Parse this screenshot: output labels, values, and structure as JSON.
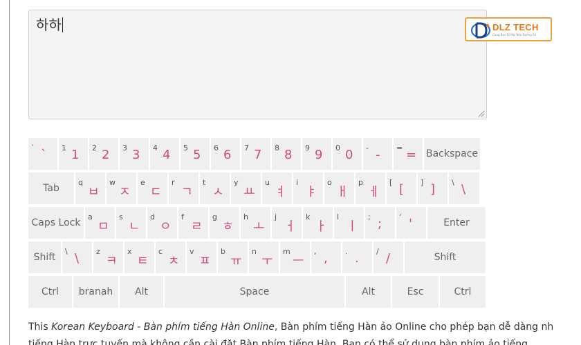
{
  "textarea": {
    "value": "하하"
  },
  "logo": {
    "text": "DLZ TECH",
    "tagline": "Cùng Bạn Đi Mọi Nẻo Đường Số"
  },
  "keyboard": {
    "rows": [
      [
        {
          "sm": "`",
          "big": "`"
        },
        {
          "sm": "1",
          "big": "1"
        },
        {
          "sm": "2",
          "big": "2"
        },
        {
          "sm": "3",
          "big": "3"
        },
        {
          "sm": "4",
          "big": "4"
        },
        {
          "sm": "5",
          "big": "5"
        },
        {
          "sm": "6",
          "big": "6"
        },
        {
          "sm": "7",
          "big": "7"
        },
        {
          "sm": "8",
          "big": "8"
        },
        {
          "sm": "9",
          "big": "9"
        },
        {
          "sm": "0",
          "big": "0"
        },
        {
          "sm": "-",
          "big": "-"
        },
        {
          "sm": "=",
          "big": "="
        },
        {
          "label": "Backspace"
        }
      ],
      [
        {
          "label": "Tab"
        },
        {
          "sm": "q",
          "big": "ㅂ"
        },
        {
          "sm": "w",
          "big": "ㅈ"
        },
        {
          "sm": "e",
          "big": "ㄷ"
        },
        {
          "sm": "r",
          "big": "ㄱ"
        },
        {
          "sm": "t",
          "big": "ㅅ"
        },
        {
          "sm": "y",
          "big": "ㅛ"
        },
        {
          "sm": "u",
          "big": "ㅕ"
        },
        {
          "sm": "i",
          "big": "ㅑ"
        },
        {
          "sm": "o",
          "big": "ㅐ"
        },
        {
          "sm": "p",
          "big": "ㅔ"
        },
        {
          "sm": "[",
          "big": "["
        },
        {
          "sm": "]",
          "big": "]"
        },
        {
          "sm": "\\",
          "big": "\\"
        }
      ],
      [
        {
          "label": "Caps Lock"
        },
        {
          "sm": "a",
          "big": "ㅁ"
        },
        {
          "sm": "s",
          "big": "ㄴ"
        },
        {
          "sm": "d",
          "big": "ㅇ"
        },
        {
          "sm": "f",
          "big": "ㄹ"
        },
        {
          "sm": "g",
          "big": "ㅎ"
        },
        {
          "sm": "h",
          "big": "ㅗ"
        },
        {
          "sm": "j",
          "big": "ㅓ"
        },
        {
          "sm": "k",
          "big": "ㅏ"
        },
        {
          "sm": "l",
          "big": "ㅣ"
        },
        {
          "sm": ";",
          "big": ";"
        },
        {
          "sm": "'",
          "big": "'"
        },
        {
          "label": "Enter"
        }
      ],
      [
        {
          "label": "Shift"
        },
        {
          "sm": "\\",
          "big": "\\"
        },
        {
          "sm": "z",
          "big": "ㅋ"
        },
        {
          "sm": "x",
          "big": "ㅌ"
        },
        {
          "sm": "c",
          "big": "ㅊ"
        },
        {
          "sm": "v",
          "big": "ㅍ"
        },
        {
          "sm": "b",
          "big": "ㅠ"
        },
        {
          "sm": "n",
          "big": "ㅜ"
        },
        {
          "sm": "m",
          "big": "ㅡ"
        },
        {
          "sm": ",",
          "big": ","
        },
        {
          "sm": ".",
          "big": "."
        },
        {
          "sm": "/",
          "big": "/"
        },
        {
          "label": "Shift"
        }
      ],
      [
        {
          "label": "Ctrl"
        },
        {
          "label": "branah"
        },
        {
          "label": "Alt"
        },
        {
          "label": "Space"
        },
        {
          "label": "Alt"
        },
        {
          "label": "Esc"
        },
        {
          "label": "Ctrl"
        }
      ]
    ]
  },
  "description": {
    "lead": "This ",
    "title_italic": "Korean Keyboard - Bàn phím tiếng Hàn Online",
    "rest": ", Bàn phím tiếng Hàn ảo Online cho phép bạn dễ dàng nh",
    "line2": "tiếng Hàn trực tuyến mà không cần cài đặt Bàn phím tiếng Hàn. Bạn có thể sử dụng bàn phím ảo tiếng"
  }
}
